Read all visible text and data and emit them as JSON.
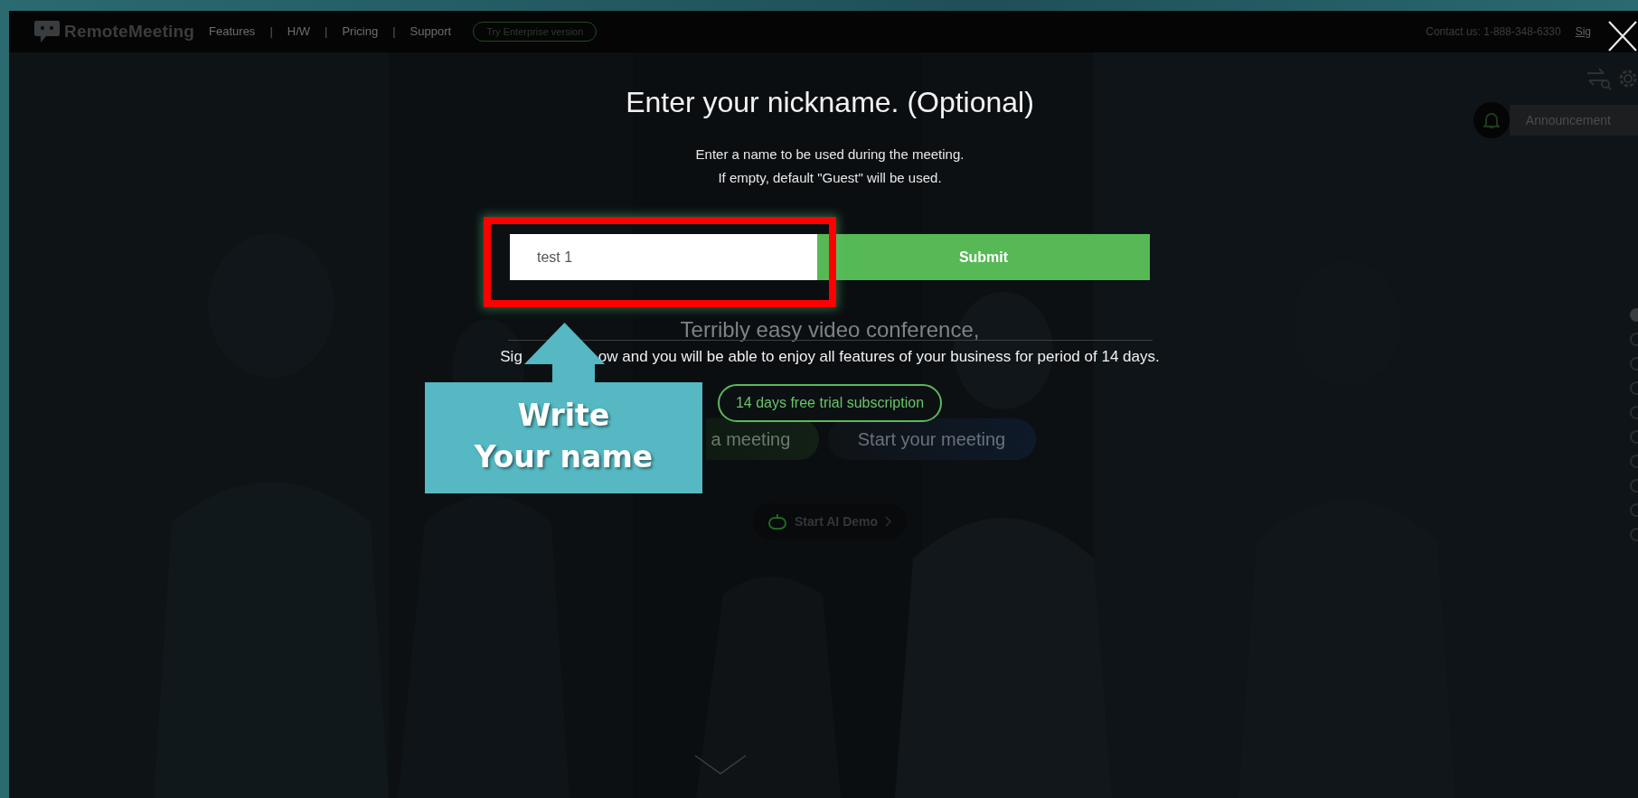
{
  "nav": {
    "logo": "RemoteMeeting",
    "items": [
      {
        "kind": "link",
        "text": "Features"
      },
      {
        "kind": "separator",
        "text": "|"
      },
      {
        "kind": "link",
        "text": "H/W"
      },
      {
        "kind": "separator",
        "text": "|"
      },
      {
        "kind": "link",
        "text": "Pricing"
      },
      {
        "kind": "separator",
        "text": "|"
      },
      {
        "kind": "link",
        "text": "Support"
      }
    ],
    "enterprise_button": "Try Enterprise version",
    "contact": "Contact us: 1-888-348-6330",
    "sign_in": "Sig"
  },
  "modal": {
    "title": "Enter your nickname. (Optional)",
    "description": [
      "Enter a name to be used during the meeting.",
      "If empty, default \"Guest\" will be used."
    ],
    "nickname_field": {
      "value": "test 1"
    },
    "submit": "Submit"
  },
  "page": {
    "tagline": "Terribly easy video conference,",
    "signup_text": [
      "Sig",
      "ow and you will be able to enjoy all features of your business for period of 14 days."
    ],
    "trial_button": "14 days free trial subscription",
    "meeting_buttons": [
      "a meeting",
      "Start your meeting"
    ],
    "ai_demo": "Start AI Demo",
    "announcement": "Announcement",
    "page_dots": [
      {
        "selected": true
      },
      {
        "selected": false
      },
      {
        "selected": false
      },
      {
        "selected": false
      },
      {
        "selected": false
      },
      {
        "selected": false
      },
      {
        "selected": false
      },
      {
        "selected": false
      },
      {
        "selected": false
      },
      {
        "selected": false
      }
    ]
  },
  "annotation": {
    "text": "Write\nYour name"
  }
}
